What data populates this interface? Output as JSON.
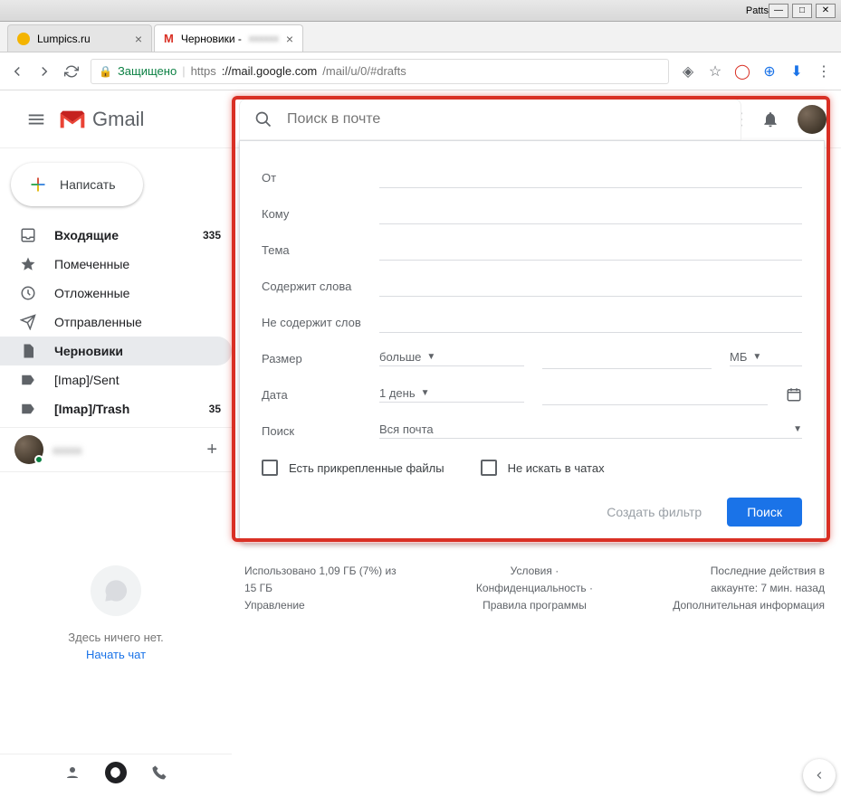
{
  "window": {
    "title": "Patts"
  },
  "tabs": [
    {
      "label": "Lumpics.ru",
      "favColor": "#f4b400"
    },
    {
      "label": "Черновики -",
      "favColor": "#d93025"
    }
  ],
  "addressbar": {
    "secure_label": "Защищено",
    "scheme": "https",
    "host": "://mail.google.com",
    "path": "/mail/u/0/#drafts"
  },
  "gmail": {
    "brand": "Gmail"
  },
  "compose": {
    "label": "Написать"
  },
  "nav": [
    {
      "icon": "inbox",
      "label": "Входящие",
      "count": "335",
      "bold": true
    },
    {
      "icon": "star",
      "label": "Помеченные",
      "count": ""
    },
    {
      "icon": "clock",
      "label": "Отложенные",
      "count": ""
    },
    {
      "icon": "send",
      "label": "Отправленные",
      "count": ""
    },
    {
      "icon": "file",
      "label": "Черновики",
      "count": "",
      "active": true,
      "bold": true
    },
    {
      "icon": "label",
      "label": "[Imap]/Sent",
      "count": ""
    },
    {
      "icon": "label",
      "label": "[Imap]/Trash",
      "count": "35",
      "bold": true
    }
  ],
  "hangouts": {
    "empty": "Здесь ничего нет.",
    "start": "Начать чат"
  },
  "search": {
    "placeholder": "Поиск в почте"
  },
  "filter": {
    "from": "От",
    "to": "Кому",
    "subject": "Тема",
    "has_words": "Содержит слова",
    "not_words": "Не содержит слов",
    "size": "Размер",
    "size_op": "больше",
    "size_unit": "МБ",
    "date": "Дата",
    "date_range": "1 день",
    "search_in": "Поиск",
    "search_in_val": "Вся почта",
    "has_attach": "Есть прикрепленные файлы",
    "no_chats": "Не искать в чатах",
    "create_filter": "Создать фильтр",
    "search_btn": "Поиск"
  },
  "footer": {
    "storage1": "Использовано 1,09 ГБ (7%) из",
    "storage2": "15 ГБ",
    "storage3": "Управление",
    "terms": "Условия",
    "privacy": "Конфиденциальность",
    "policies": "Правила программы",
    "activity1": "Последние действия в",
    "activity2": "аккаунте: 7 мин. назад",
    "activity3": "Дополнительная информация"
  }
}
